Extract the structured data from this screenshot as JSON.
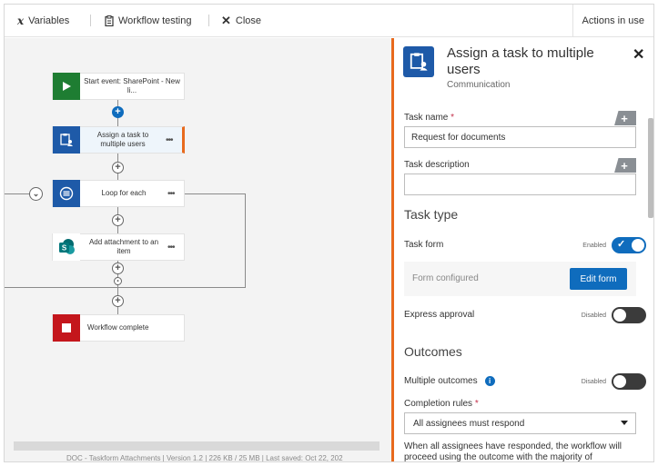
{
  "toolbar": {
    "variables_label": "Variables",
    "workflow_testing_label": "Workflow testing",
    "close_label": "Close",
    "actions_in_use_label": "Actions in use"
  },
  "canvas": {
    "nodes": [
      {
        "label": "Start event: SharePoint - New li...",
        "icon": "play-icon",
        "color": "#1e7d32"
      },
      {
        "label": "Assign a task to multiple users",
        "icon": "task-assign-icon",
        "color": "#1e5aa8"
      },
      {
        "label": "Loop for each",
        "icon": "loop-icon",
        "color": "#1e5aa8"
      },
      {
        "label": "Add attachment to an item",
        "icon": "sharepoint-icon",
        "color": "#03787c"
      },
      {
        "label": "Workflow complete",
        "icon": "stop-icon",
        "color": "#c4161c"
      }
    ],
    "status_line": "DOC - Taskform Attachments  |  Version 1.2  |  226 KB / 25 MB  |  Last saved: Oct 22, 202"
  },
  "panel": {
    "title": "Assign a task to multiple users",
    "subtitle": "Communication",
    "task_name": {
      "label": "Task name",
      "required_mark": "*",
      "value": "Request for documents"
    },
    "task_description": {
      "label": "Task description",
      "value": ""
    },
    "task_type_heading": "Task type",
    "task_form": {
      "label": "Task form",
      "state_label": "Enabled",
      "form_status": "Form configured",
      "edit_button": "Edit form"
    },
    "express_approval": {
      "label": "Express approval",
      "state_label": "Disabled"
    },
    "outcomes_heading": "Outcomes",
    "multiple_outcomes": {
      "label": "Multiple outcomes",
      "info_glyph": "i",
      "state_label": "Disabled"
    },
    "completion_rules": {
      "label": "Completion rules",
      "required_mark": "*",
      "selected": "All assignees must respond"
    },
    "note": "When all assignees have responded, the workflow will proceed using the outcome with the majority of"
  },
  "colors": {
    "accent": "#0f6cbd",
    "active_border": "#e86a1d",
    "start_green": "#1e7d32",
    "stop_red": "#c4161c"
  }
}
